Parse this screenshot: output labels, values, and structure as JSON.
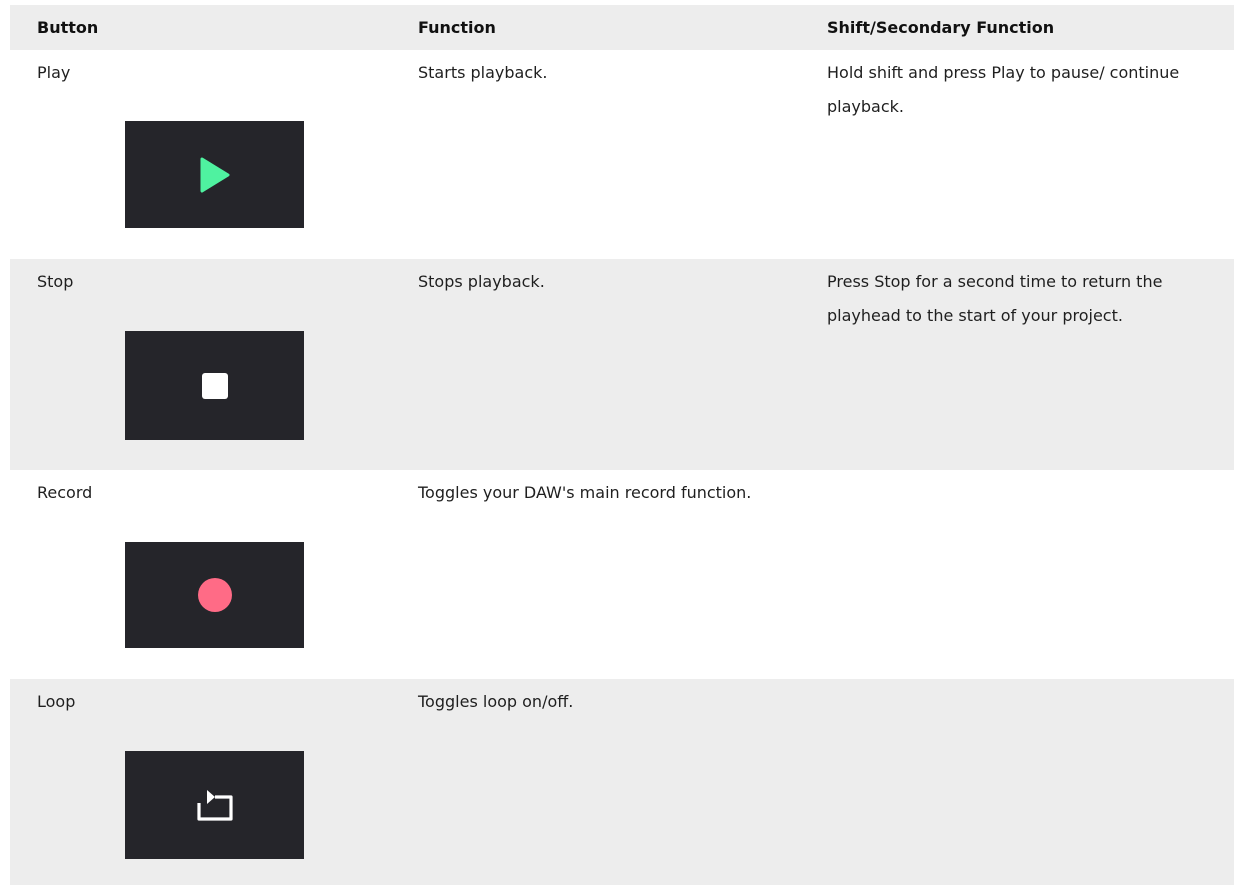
{
  "table": {
    "headers": [
      "Button",
      "Function",
      "Shift/Secondary Function"
    ],
    "rows": [
      {
        "button": "Play",
        "function": "Starts playback.",
        "secondary": "Hold shift and press Play to pause/ continue playback.",
        "icon": "play-icon",
        "icon_color": "#4ff2a0"
      },
      {
        "button": "Stop",
        "function": "Stops playback.",
        "secondary": "Press Stop for a second time to return the playhead to the start of your project.",
        "icon": "stop-icon",
        "icon_color": "#ffffff"
      },
      {
        "button": "Record",
        "function": "Toggles your DAW's main record function.",
        "secondary": "",
        "icon": "record-icon",
        "icon_color": "#ff6b86"
      },
      {
        "button": "Loop",
        "function": "Toggles loop on/off.",
        "secondary": "",
        "icon": "loop-icon",
        "icon_color": "#ffffff"
      }
    ]
  },
  "colors": {
    "row_shade": "#ededed",
    "button_bg": "#25252a"
  }
}
